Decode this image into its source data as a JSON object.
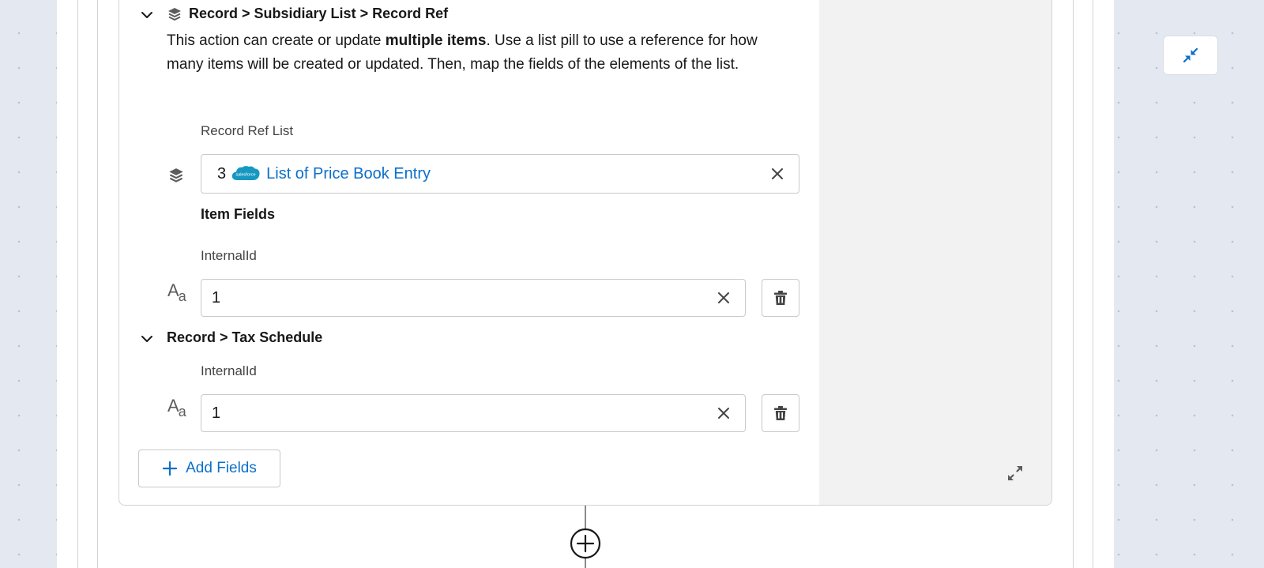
{
  "section1": {
    "title": "Record > Subsidiary List > Record Ref",
    "desc_before": "This action can create or update ",
    "desc_bold": "multiple items",
    "desc_after": ". Use a list pill to use a reference for how many items will be created or updated. Then, map the fields of the elements of the list.",
    "record_ref_list": {
      "label": "Record Ref List",
      "pill_count": "3",
      "pill_text": "List of Price Book Entry",
      "pill_logo_text": "salesforce"
    },
    "item_fields": {
      "title": "Item Fields",
      "field": {
        "label": "InternalId",
        "value": "1"
      }
    }
  },
  "section2": {
    "title": "Record > Tax Schedule",
    "field": {
      "label": "InternalId",
      "value": "1"
    }
  },
  "type_icon_text": {
    "big": "A",
    "small": "a"
  },
  "add_fields_label": "Add Fields",
  "icons": {
    "chevron": "chevron-down-icon",
    "layers": "layers-icon",
    "close": "close-icon",
    "trash": "trash-icon",
    "add": "add-icon",
    "expand": "expand-icon",
    "collapse": "collapse-icon",
    "add_step": "add-step-icon"
  },
  "colors": {
    "brand": "#0b6fca",
    "salesforce_blue": "#1798c1"
  }
}
